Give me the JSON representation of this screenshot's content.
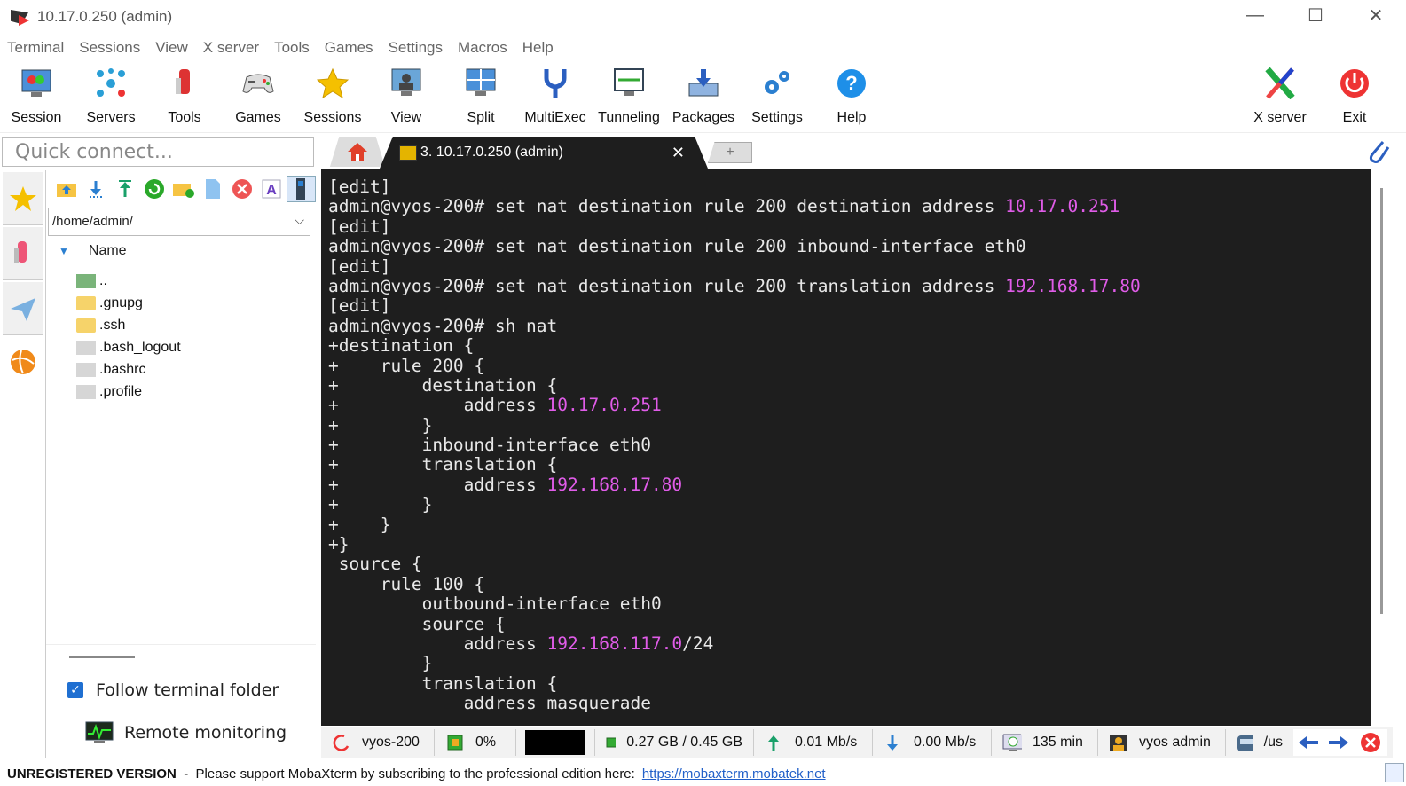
{
  "window": {
    "title": "10.17.0.250 (admin)",
    "minimize": "—",
    "maximize": "☐",
    "close": "✕"
  },
  "menu": [
    "Terminal",
    "Sessions",
    "View",
    "X server",
    "Tools",
    "Games",
    "Settings",
    "Macros",
    "Help"
  ],
  "toolbar": {
    "session": "Session",
    "servers": "Servers",
    "tools": "Tools",
    "games": "Games",
    "sessions": "Sessions",
    "view": "View",
    "split": "Split",
    "multiexec": "MultiExec",
    "tunneling": "Tunneling",
    "packages": "Packages",
    "settings": "Settings",
    "help": "Help",
    "xserver": "X server",
    "exit": "Exit"
  },
  "quick_connect": {
    "placeholder": "Quick connect..."
  },
  "tabs": {
    "session_tab": "3. 10.17.0.250 (admin)",
    "close": "✕",
    "new_tab": "+"
  },
  "file_panel": {
    "path": "/home/admin/",
    "header": "Name",
    "items": [
      "..",
      ".gnupg",
      ".ssh",
      ".bash_logout",
      ".bashrc",
      ".profile"
    ],
    "follow_label": "Follow terminal folder",
    "follow_checked": true,
    "remote_label": "Remote monitoring"
  },
  "terminal": {
    "lines": [
      [
        "[edit]",
        ""
      ],
      [
        "admin@vyos-200# set nat destination rule 200 destination address ",
        "10.17.0.251"
      ],
      [
        "[edit]",
        ""
      ],
      [
        "admin@vyos-200# set nat destination rule 200 inbound-interface eth0",
        ""
      ],
      [
        "[edit]",
        ""
      ],
      [
        "admin@vyos-200# set nat destination rule 200 translation address ",
        "192.168.17.80"
      ],
      [
        "[edit]",
        ""
      ],
      [
        "admin@vyos-200# sh nat",
        ""
      ],
      [
        "+destination {",
        ""
      ],
      [
        "+    rule 200 {",
        ""
      ],
      [
        "+        destination {",
        ""
      ],
      [
        "+            address ",
        "10.17.0.251"
      ],
      [
        "+        }",
        ""
      ],
      [
        "+        inbound-interface eth0",
        ""
      ],
      [
        "+        translation {",
        ""
      ],
      [
        "+            address ",
        "192.168.17.80"
      ],
      [
        "+        }",
        ""
      ],
      [
        "+    }",
        ""
      ],
      [
        "+}",
        ""
      ],
      [
        " source {",
        ""
      ],
      [
        "     rule 100 {",
        ""
      ],
      [
        "         outbound-interface eth0",
        ""
      ],
      [
        "         source {",
        ""
      ],
      [
        "             address ",
        "192.168.117.0",
        "/24"
      ],
      [
        "         }",
        ""
      ],
      [
        "         translation {",
        ""
      ],
      [
        "             address masquerade",
        ""
      ]
    ]
  },
  "status": {
    "host": "vyos-200",
    "cpu": "0%",
    "memory": "0.27 GB / 0.45 GB",
    "upload": "0.01 Mb/s",
    "download": "0.00 Mb/s",
    "uptime": "135 min",
    "user": "vyos  admin",
    "path": "/us"
  },
  "footer": {
    "unregistered": "UNREGISTERED VERSION",
    "message": "  -  Please support MobaXterm by subscribing to the professional edition here:",
    "link": "https://mobaxterm.mobatek.net"
  }
}
